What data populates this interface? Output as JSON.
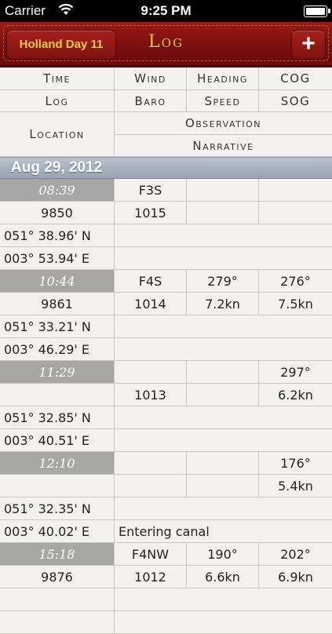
{
  "status_bar": {
    "carrier": "Carrier",
    "time": "9:25 PM"
  },
  "nav": {
    "back_label": "Holland Day 11",
    "title": "Log",
    "add_label": "+"
  },
  "columns": {
    "row1": [
      "Time",
      "Wind",
      "Heading",
      "COG"
    ],
    "row2": [
      "Log",
      "Baro",
      "Speed",
      "SOG"
    ],
    "location": "Location",
    "observation": "Observation",
    "narrative": "Narrative"
  },
  "section_date": "Aug 29, 2012",
  "entries": [
    {
      "time": "08:39",
      "wind": "F3S",
      "heading": "",
      "cog": "",
      "log": "9850",
      "baro": "1015",
      "speed": "",
      "sog": "",
      "lat": "051° 38.96' N",
      "lon": "003° 53.94' E",
      "observation": "",
      "narrative": ""
    },
    {
      "time": "10:44",
      "wind": "F4S",
      "heading": "279°",
      "cog": "276°",
      "log": "9861",
      "baro": "1014",
      "speed": "7.2kn",
      "sog": "7.5kn",
      "lat": "051° 33.21' N",
      "lon": "003° 46.29' E",
      "observation": "",
      "narrative": ""
    },
    {
      "time": "11:29",
      "wind": "",
      "heading": "",
      "cog": "297°",
      "log": "",
      "baro": "1013",
      "speed": "",
      "sog": "6.2kn",
      "lat": "051° 32.85' N",
      "lon": "003° 40.51' E",
      "observation": "",
      "narrative": ""
    },
    {
      "time": "12:10",
      "wind": "",
      "heading": "",
      "cog": "176°",
      "log": "",
      "baro": "",
      "speed": "",
      "sog": "5.4kn",
      "lat": "051° 32.35' N",
      "lon": "003° 40.02' E",
      "observation": "",
      "narrative": "Entering canal"
    },
    {
      "time": "15:18",
      "wind": "F4NW",
      "heading": "190°",
      "cog": "202°",
      "log": "9876",
      "baro": "1012",
      "speed": "6.6kn",
      "sog": "6.9kn",
      "lat": "",
      "lon": "",
      "observation": "",
      "narrative": ""
    }
  ]
}
